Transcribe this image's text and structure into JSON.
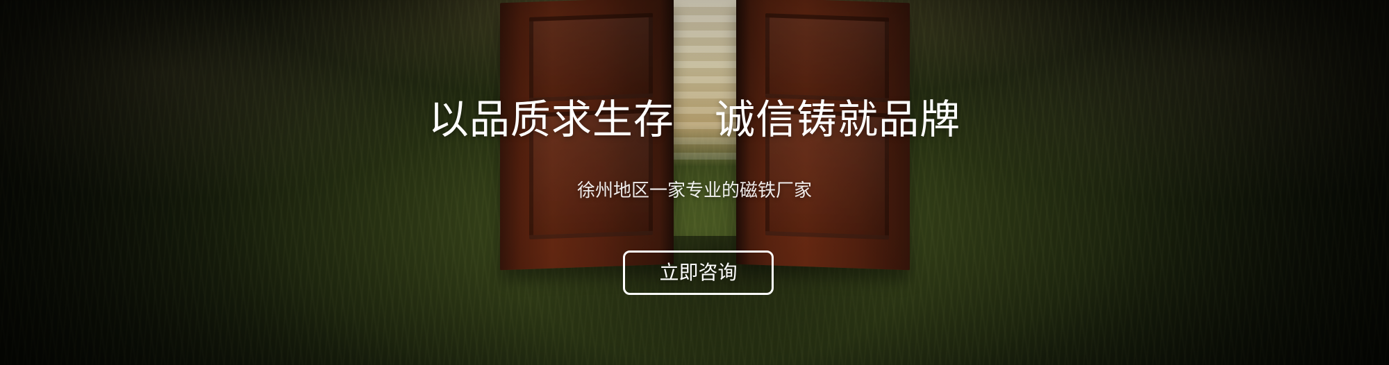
{
  "hero": {
    "headline": "以品质求生存   诚信铸就品牌",
    "subheadline": "徐州地区一家专业的磁铁厂家",
    "cta_label": "立即咨询"
  },
  "colors": {
    "text": "#ffffff",
    "button_border": "#ffffff",
    "grass_dark": "#151b0c",
    "grass_mid": "#2f3b16",
    "door_wood": "#6d2b13",
    "light": "#fff6da"
  }
}
